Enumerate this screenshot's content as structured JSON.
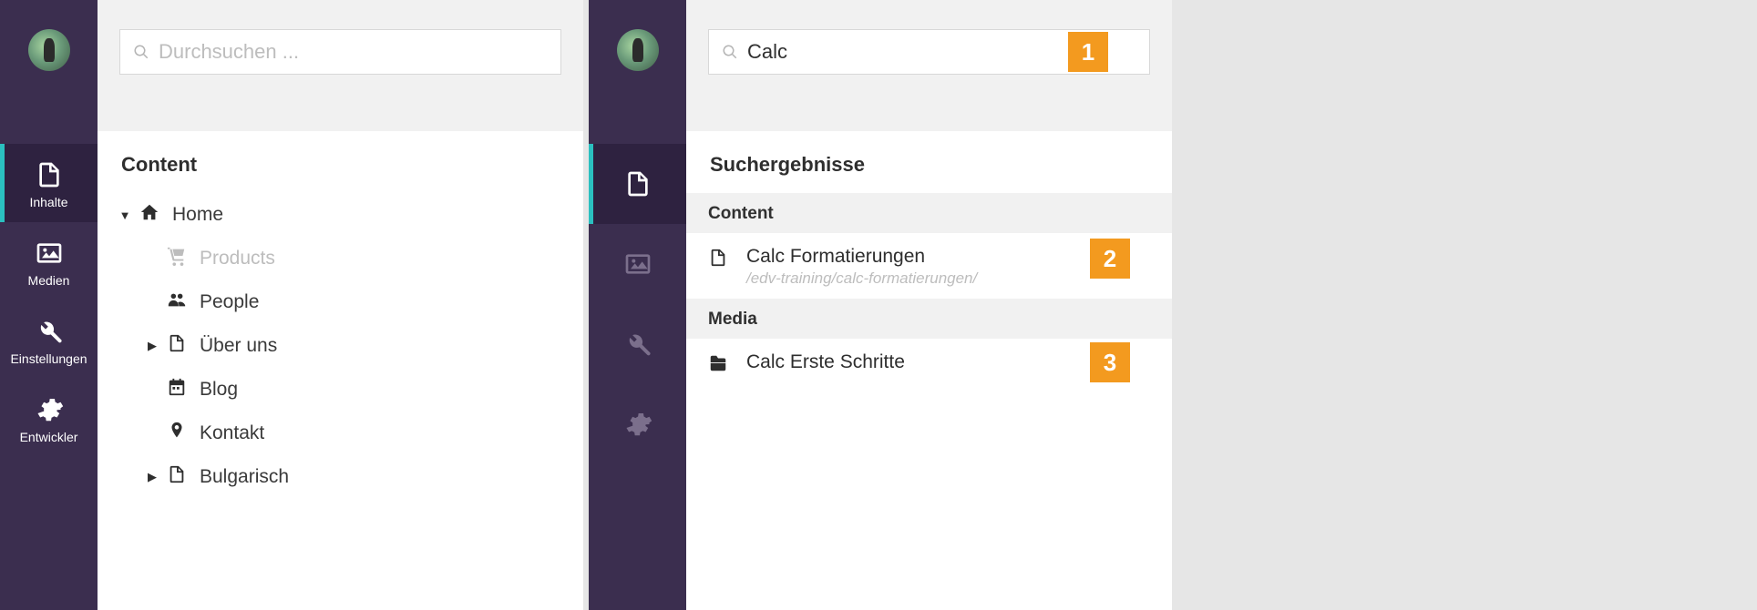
{
  "colors": {
    "accent": "#f39a1f",
    "sidebar": "#3b2e4f",
    "active_indicator": "#2bc0c0"
  },
  "left": {
    "search": {
      "placeholder": "Durchsuchen ...",
      "value": ""
    },
    "nav": {
      "inhalte": "Inhalte",
      "medien": "Medien",
      "einstellungen": "Einstellungen",
      "entwickler": "Entwickler"
    },
    "section_title": "Content",
    "tree": {
      "home": "Home",
      "products": "Products",
      "people": "People",
      "ueber_uns": "Über uns",
      "blog": "Blog",
      "kontakt": "Kontakt",
      "bulgarisch": "Bulgarisch"
    }
  },
  "right": {
    "search": {
      "placeholder": "",
      "value": "Calc"
    },
    "section_title": "Suchergebnisse",
    "groups": {
      "content": {
        "header": "Content",
        "item_title": "Calc Formatierungen",
        "item_path": "/edv-training/calc-formatierungen/"
      },
      "media": {
        "header": "Media",
        "item_title": "Calc Erste Schritte"
      }
    },
    "markers": {
      "m1": "1",
      "m2": "2",
      "m3": "3"
    }
  }
}
